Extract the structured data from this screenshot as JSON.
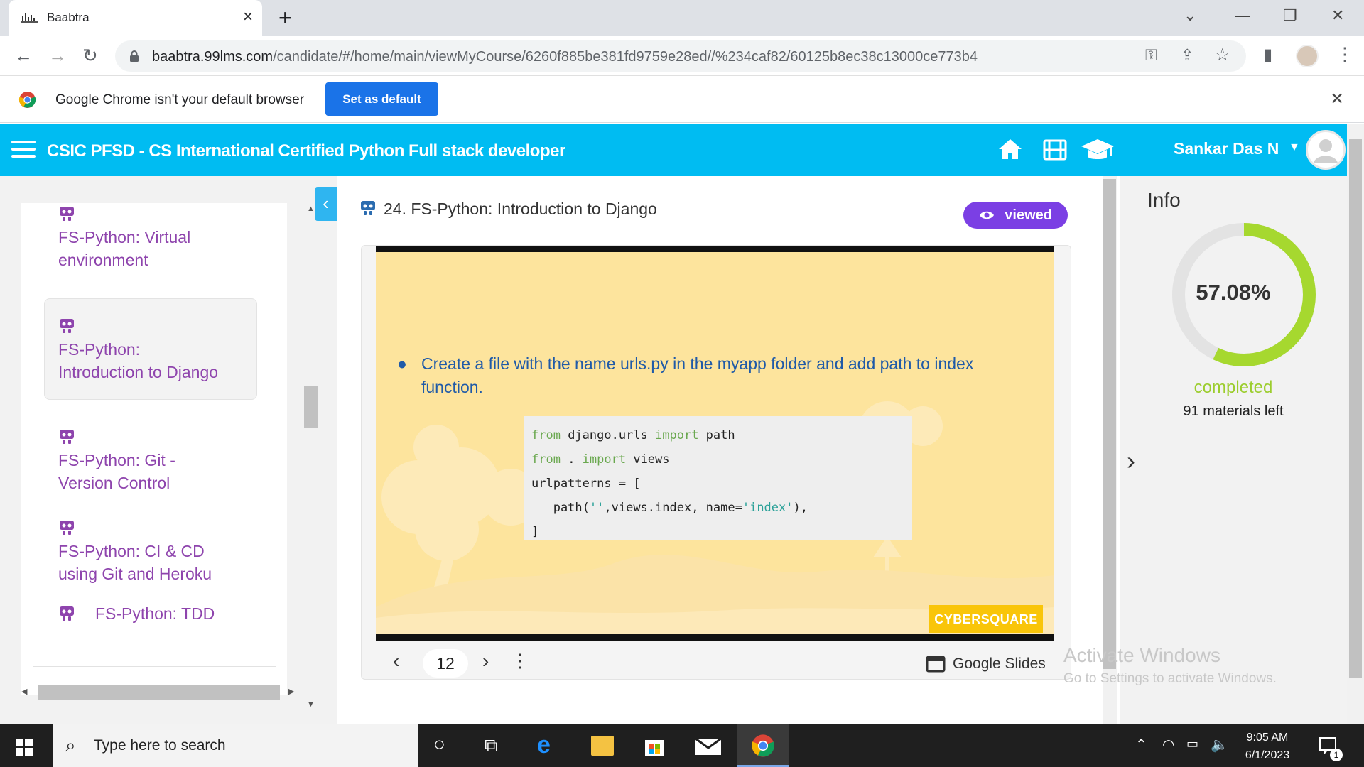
{
  "browser": {
    "tab_title": "Baabtra",
    "url_host": "baabtra.99lms.com",
    "url_path": "/candidate/#/home/main/viewMyCourse/6260f885be381fd9759e28ed//%234caf82/60125b8ec38c13000ce773b4"
  },
  "infobar": {
    "message": "Google Chrome isn't your default browser",
    "button": "Set as default"
  },
  "header": {
    "course_title": "CSIC PFSD - CS International Certified Python Full stack developer",
    "user_name": "Sankar Das N"
  },
  "sidebar": {
    "lessons": [
      {
        "label_1": "FS-Python: Virtual",
        "label_2": "environment"
      },
      {
        "label_1": "FS-Python:",
        "label_2": "Introduction to Django",
        "active": true
      },
      {
        "label_1": "FS-Python: Git -",
        "label_2": "Version Control"
      },
      {
        "label_1": "FS-Python: CI & CD",
        "label_2": "using Git and Heroku"
      },
      {
        "label_1": "FS-Python: TDD",
        "label_2": ""
      }
    ]
  },
  "lesson": {
    "title": "24. FS-Python: Introduction to Django",
    "status": "viewed"
  },
  "slide": {
    "bullet": "Create a file with the name urls.py in the myapp folder and add path to index function.",
    "brand": "CYBERSQUARE",
    "page": "12",
    "app_label": "Google Slides"
  },
  "info": {
    "title": "Info",
    "progress_percent": 57.08,
    "progress_label": "57.08%",
    "completed_label": "completed",
    "materials_left": "91 materials left"
  },
  "windows": {
    "activate_title": "Activate Windows",
    "activate_sub": "Go to Settings to activate Windows.",
    "search_placeholder": "Type here to search",
    "time": "9:05 AM",
    "date": "6/1/2023",
    "notifications": "1"
  },
  "colors": {
    "header": "#00bcf2",
    "lesson_text": "#8e44ad",
    "viewed_badge": "#7b3fe4",
    "progress": "#a6d82f"
  }
}
